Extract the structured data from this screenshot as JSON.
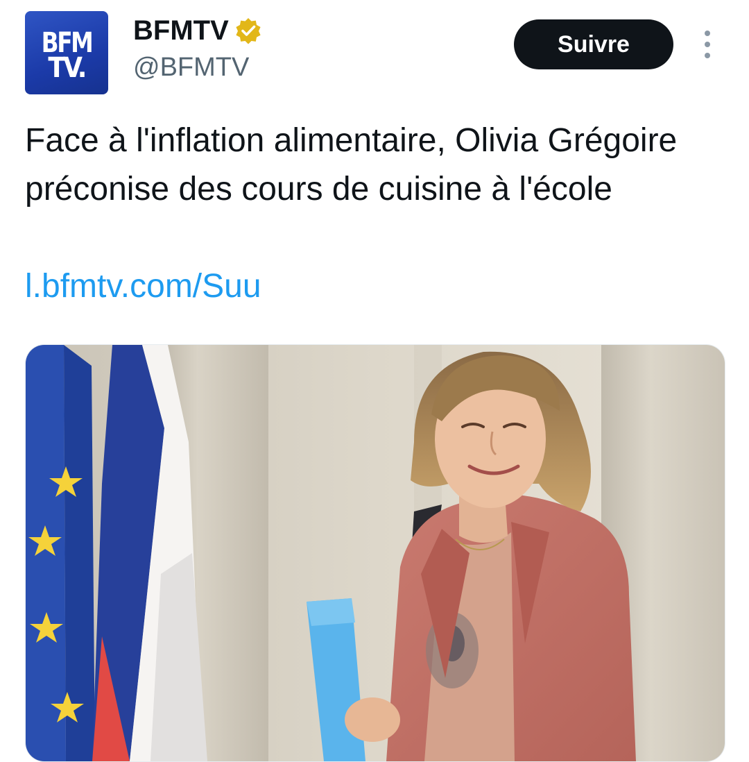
{
  "author": {
    "display_name": "BFMTV",
    "handle": "@BFMTV",
    "verified": true,
    "avatar_logo": [
      "BFM",
      "TV."
    ],
    "avatar_color": "#1b3aa8",
    "verified_badge_color": "#e2b719"
  },
  "actions": {
    "follow_label": "Suivre",
    "more_icon": "more-vertical-icon"
  },
  "tweet": {
    "text": "Face à l'inflation alimentaire, Olivia Grégoire préconise des cours de cuisine à l'école",
    "link_text": "l.bfmtv.com/Suu",
    "link_color": "#1d9bf0"
  },
  "media": {
    "type": "photo"
  }
}
